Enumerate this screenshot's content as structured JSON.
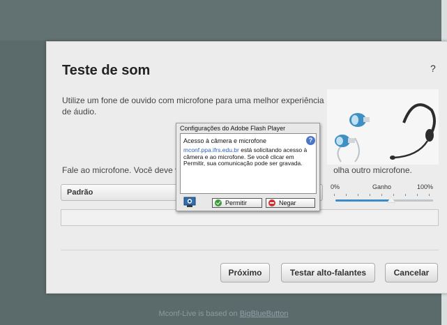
{
  "dialog": {
    "title": "Teste de som",
    "help": "?",
    "intro": "Utilize um fone de ouvido com microfone para uma melhor experiência de áudio.",
    "speak_prefix": "Fale ao microfone. Você deve v",
    "speak_suffix": "olha outro microfone.",
    "mic_selected": "Padrão",
    "gain": {
      "min_label": "0%",
      "mid_label": "Ganho",
      "max_label": "100%",
      "value_percent": 57
    },
    "buttons": {
      "next": "Próximo",
      "test_speakers": "Testar alto-falantes",
      "cancel": "Cancelar"
    }
  },
  "flash": {
    "title": "Configurações do Adobe Flash Player",
    "heading": "Acesso à câmera e microfone",
    "help": "?",
    "domain": "mconf.ppa.ifrs.edu.br",
    "message": " está solicitando acesso à câmera e ao microfone. Se você clicar em Permitir, sua comunicação pode ser gravada.",
    "allow_label": "Permitir",
    "deny_label": "Negar"
  },
  "footer": {
    "prefix": "Mconf-Live is based on ",
    "link": "BigBlueButton"
  },
  "colors": {
    "accent": "#3a8bc9",
    "link": "#2a5fb8",
    "allow": "#3a9a3a",
    "deny": "#d23030"
  }
}
